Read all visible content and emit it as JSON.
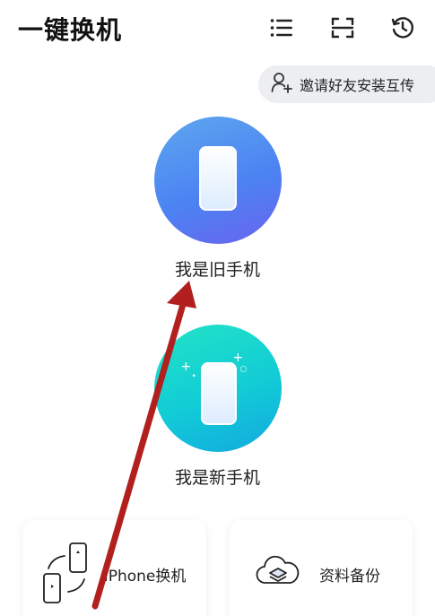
{
  "header": {
    "title": "一键换机",
    "icons": [
      "menu-icon",
      "scan-icon",
      "history-icon"
    ]
  },
  "invite": {
    "label": "邀请好友安装互传",
    "icon": "add-user-icon"
  },
  "roles": {
    "old": {
      "label": "我是旧手机",
      "icon": "phone-icon"
    },
    "new": {
      "label": "我是新手机",
      "icon": "phone-icon"
    }
  },
  "cards": {
    "phone_transfer": {
      "label": "iPhone换机",
      "icon": "phone-transfer-icon"
    },
    "backup": {
      "label": "资料备份",
      "icon": "cloud-backup-icon"
    }
  },
  "colors": {
    "old_gradient": [
      "#5fa6ef",
      "#6a63ef"
    ],
    "new_gradient": [
      "#22e3c6",
      "#13a8df"
    ],
    "annotation_arrow": "#b21f1f"
  }
}
